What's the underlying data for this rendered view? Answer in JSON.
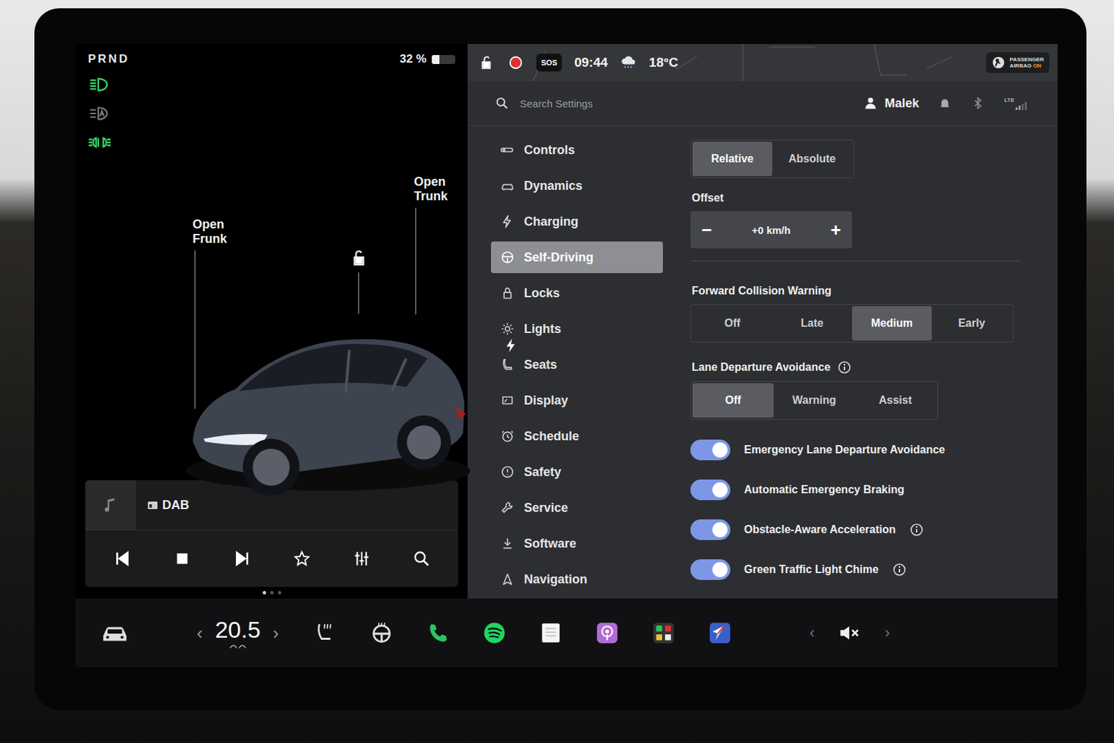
{
  "status": {
    "gear": "PRND",
    "battery": "32 %",
    "battery_level": 0.32,
    "sos": "SOS",
    "time": "09:44",
    "temperature": "18°C",
    "airbag": {
      "line1": "PASSENGER",
      "line2": "AIRBAG",
      "state": "ON"
    }
  },
  "light_indicators": [
    {
      "kind": "headlights",
      "on": true
    },
    {
      "kind": "auto",
      "on": false
    },
    {
      "kind": "parking",
      "on": true
    }
  ],
  "vehicle": {
    "frunk_label": [
      "Open",
      "Frunk"
    ],
    "trunk_label": [
      "Open",
      "Trunk"
    ],
    "locked": false,
    "charging": true
  },
  "media": {
    "source": "DAB"
  },
  "page_dots": [
    {
      "selected": true
    },
    {
      "selected": false
    },
    {
      "selected": false
    }
  ],
  "header": {
    "search_placeholder": "Search Settings",
    "user": "Malek",
    "network": "LTE"
  },
  "menu": [
    {
      "label": "Controls",
      "selected": false
    },
    {
      "label": "Dynamics",
      "selected": false
    },
    {
      "label": "Charging",
      "selected": false
    },
    {
      "label": "Self-Driving",
      "selected": true
    },
    {
      "label": "Locks",
      "selected": false
    },
    {
      "label": "Lights",
      "selected": false
    },
    {
      "label": "Seats",
      "selected": false
    },
    {
      "label": "Display",
      "selected": false
    },
    {
      "label": "Schedule",
      "selected": false
    },
    {
      "label": "Safety",
      "selected": false
    },
    {
      "label": "Service",
      "selected": false
    },
    {
      "label": "Software",
      "selected": false
    },
    {
      "label": "Navigation",
      "selected": false
    }
  ],
  "speed_mode": [
    {
      "label": "Relative",
      "selected": true
    },
    {
      "label": "Absolute",
      "selected": false
    }
  ],
  "offset": {
    "label": "Offset",
    "value": "+0 km/h",
    "minus": "−",
    "plus": "+"
  },
  "collision_warning": {
    "label": "Forward Collision Warning",
    "options": [
      {
        "label": "Off",
        "selected": false
      },
      {
        "label": "Late",
        "selected": false
      },
      {
        "label": "Medium",
        "selected": true
      },
      {
        "label": "Early",
        "selected": false
      }
    ]
  },
  "lane_departure": {
    "label": "Lane Departure Avoidance",
    "info": true,
    "options": [
      {
        "label": "Off",
        "selected": true
      },
      {
        "label": "Warning",
        "selected": false
      },
      {
        "label": "Assist",
        "selected": false
      }
    ]
  },
  "toggles": [
    {
      "label": "Emergency Lane Departure Avoidance",
      "on": true,
      "info": false
    },
    {
      "label": "Automatic Emergency Braking",
      "on": true,
      "info": false
    },
    {
      "label": "Obstacle-Aware Acceleration",
      "on": true,
      "info": true
    },
    {
      "label": "Green Traffic Light Chime",
      "on": true,
      "info": true
    }
  ],
  "climate": {
    "prev": "‹",
    "temperature": "20.5",
    "next": "›"
  },
  "volume": {
    "prev": "‹",
    "muted": true,
    "next": "›"
  }
}
